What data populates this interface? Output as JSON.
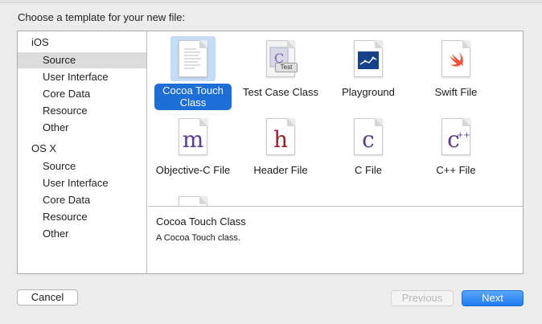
{
  "dialog": {
    "prompt": "Choose a template for your new file:"
  },
  "sidebar": {
    "groups": [
      {
        "title": "iOS",
        "items": [
          "Source",
          "User Interface",
          "Core Data",
          "Resource",
          "Other"
        ],
        "selected": "Source"
      },
      {
        "title": "OS X",
        "items": [
          "Source",
          "User Interface",
          "Core Data",
          "Resource",
          "Other"
        ]
      }
    ]
  },
  "templates": [
    {
      "label": "Cocoa Touch Class",
      "icon": "cocoa-touch-class-icon",
      "selected": true
    },
    {
      "label": "Test Case Class",
      "icon": "test-case-class-icon",
      "badge": "Test"
    },
    {
      "label": "Playground",
      "icon": "playground-icon"
    },
    {
      "label": "Swift File",
      "icon": "swift-file-icon"
    },
    {
      "label": "Objective-C File",
      "icon": "objective-c-file-icon",
      "glyph": "m"
    },
    {
      "label": "Header File",
      "icon": "header-file-icon",
      "glyph": "h"
    },
    {
      "label": "C File",
      "icon": "c-file-icon",
      "glyph": "c"
    },
    {
      "label": "C++ File",
      "icon": "cpp-file-icon",
      "glyph": "c",
      "glyph_suffix": "++"
    }
  ],
  "description": {
    "title": "Cocoa Touch Class",
    "text": "A Cocoa Touch class."
  },
  "buttons": {
    "cancel": "Cancel",
    "previous": "Previous",
    "next": "Next"
  },
  "colors": {
    "selection_blue": "#1d6fd7",
    "selection_light": "#c5dcf6",
    "swift_orange": "#f05138",
    "playground_navy": "#17418a",
    "objc_purple": "#5c3d8f",
    "header_red": "#a0202a",
    "next_button": "#1d7cf2"
  }
}
